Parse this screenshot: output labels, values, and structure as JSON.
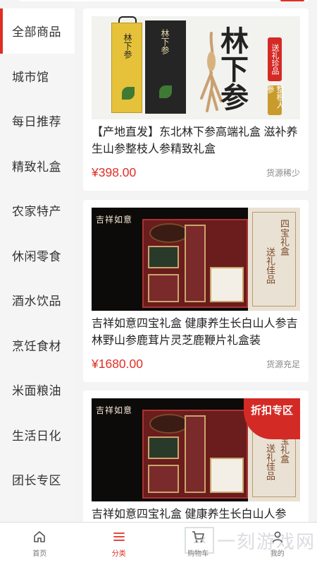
{
  "sidebar": {
    "items": [
      {
        "label": "全部商品",
        "active": true
      },
      {
        "label": "城市馆"
      },
      {
        "label": "每日推荐"
      },
      {
        "label": "精致礼盒"
      },
      {
        "label": "农家特产"
      },
      {
        "label": "休闲零食"
      },
      {
        "label": "酒水饮品"
      },
      {
        "label": "烹饪食材"
      },
      {
        "label": "米面粮油"
      },
      {
        "label": "生活日化"
      },
      {
        "label": "团长专区"
      }
    ]
  },
  "products": [
    {
      "title": "【产地直发】东北林下参高端礼盒 滋补养生山参整枝人参精致礼盒",
      "price": "¥398.00",
      "stock": "货源稀少",
      "image": {
        "box_gold_label": "林下参",
        "box_dark_label": "林下参",
        "calligraphy": "林下参",
        "badge_red": "送礼珍品",
        "badge_gold": "整根人参"
      }
    },
    {
      "title": "吉祥如意四宝礼盒 健康养生长白山人参吉林野山参鹿茸片灵芝鹿鞭片礼盒装",
      "price": "¥1680.00",
      "stock": "货源充足",
      "image": {
        "logo": "吉祥如意",
        "lid_text_1": "四宝礼盒",
        "lid_text_2": "送礼佳品"
      }
    },
    {
      "title": "吉祥如意四宝礼盒 健康养生长白山人参",
      "image": {
        "logo": "吉祥如意",
        "lid_text_1": "四宝礼盒",
        "lid_text_2": "送礼佳品",
        "discount": "折扣专区"
      }
    }
  ],
  "tabbar": {
    "items": [
      {
        "label": "首页",
        "icon": "home-icon"
      },
      {
        "label": "分类",
        "icon": "category-icon",
        "active": true
      },
      {
        "label": "购物车",
        "icon": "cart-icon"
      },
      {
        "label": "我的",
        "icon": "user-icon"
      }
    ]
  },
  "watermark": {
    "box": "1x",
    "text": "一刻游戏网"
  },
  "colors": {
    "accent": "#e02e24",
    "sidebar_bg": "#f5f5f5",
    "content_bg": "#f4f4f4"
  }
}
